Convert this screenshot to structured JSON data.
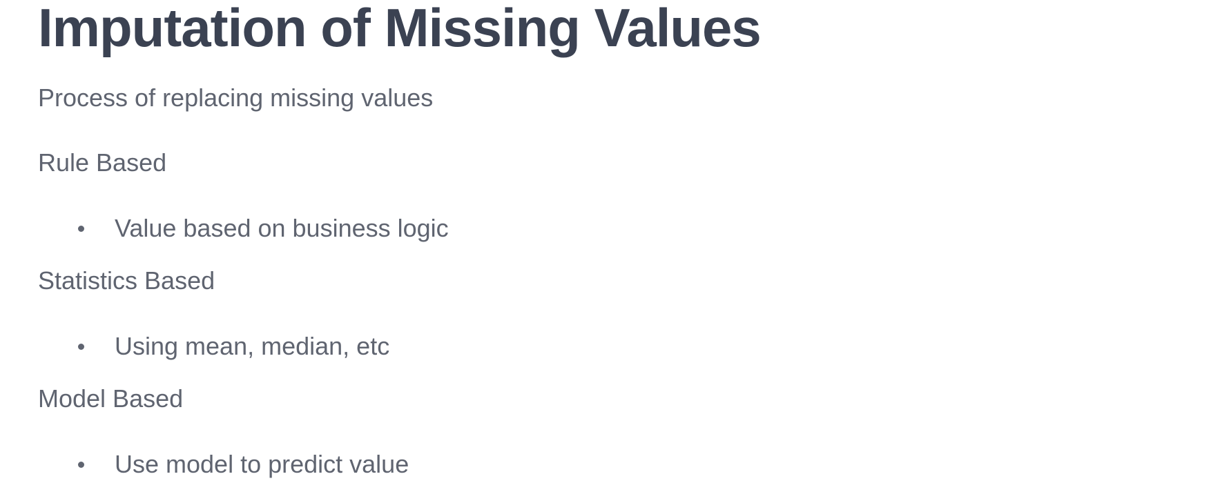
{
  "slide": {
    "title": "Imputation of Missing Values",
    "subtitle": "Process of replacing missing values",
    "sections": [
      {
        "heading": "Rule Based",
        "bullets": [
          "Value based on business logic"
        ]
      },
      {
        "heading": "Statistics Based",
        "bullets": [
          "Using mean, median, etc"
        ]
      },
      {
        "heading": "Model Based",
        "bullets": [
          "Use model to predict value"
        ]
      }
    ],
    "colors": {
      "title": "#3b4252",
      "body_text": "#5f6470",
      "background": "#ffffff"
    }
  }
}
